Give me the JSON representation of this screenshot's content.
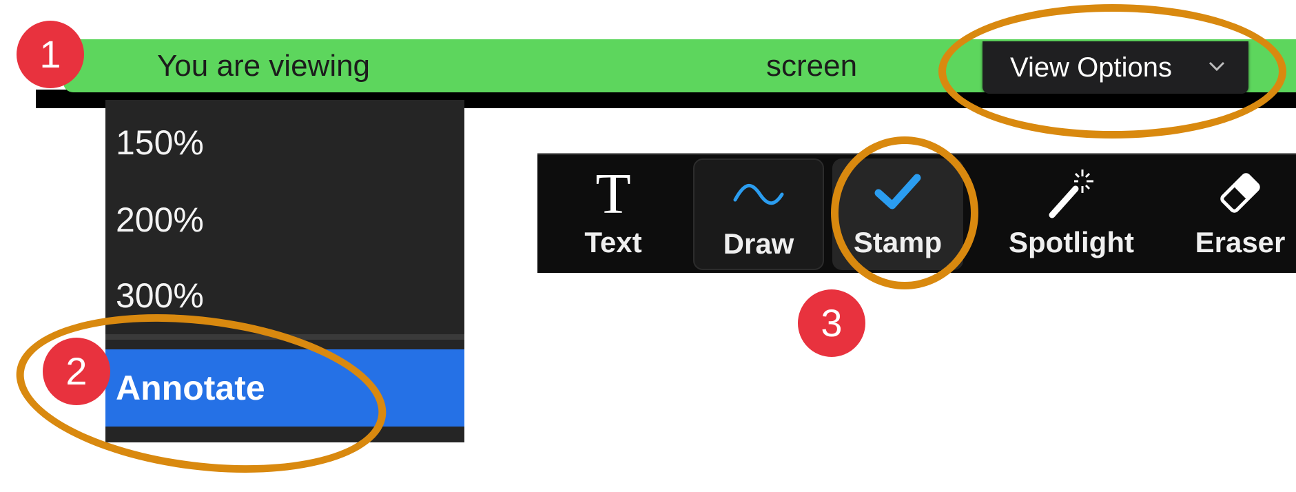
{
  "viewing_bar": {
    "viewing_text": "You are viewing",
    "screen_text": "screen",
    "view_options_label": "View Options",
    "chevron": "⌄",
    "bar_color": "#5dd65d"
  },
  "view_menu": {
    "zoom_options": [
      "150%",
      "200%",
      "300%"
    ],
    "annotate_label": "Annotate",
    "highlight_color": "#2571e6"
  },
  "annotation_toolbar": {
    "text_icon": "T",
    "tools": {
      "text": {
        "label": "Text",
        "icon": "text-T-icon"
      },
      "draw": {
        "label": "Draw",
        "icon": "squiggle-icon"
      },
      "stamp": {
        "label": "Stamp",
        "icon": "checkmark-icon"
      },
      "spotlight": {
        "label": "Spotlight",
        "icon": "magic-wand-icon"
      },
      "eraser": {
        "label": "Eraser",
        "icon": "eraser-icon"
      }
    },
    "accent_color": "#2b9df0"
  },
  "callouts": {
    "badges": [
      "1",
      "2",
      "3"
    ],
    "badge_color": "#e8323e",
    "ring_color": "#d9890f"
  }
}
